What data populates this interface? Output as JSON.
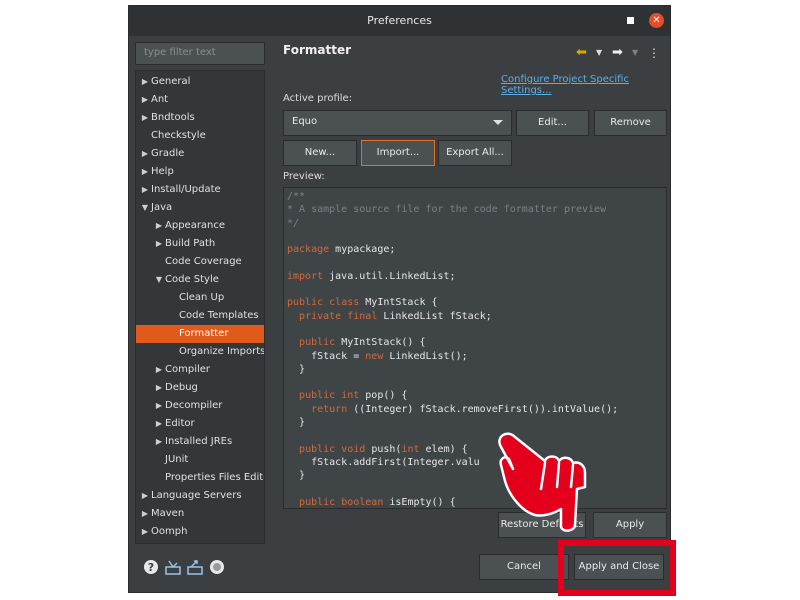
{
  "window": {
    "title": "Preferences",
    "close_glyph": "✕"
  },
  "sidebar": {
    "filter_placeholder": "type filter text",
    "items": [
      {
        "label": "General",
        "expand": "▶"
      },
      {
        "label": "Ant",
        "expand": "▶"
      },
      {
        "label": "Bndtools",
        "expand": "▶"
      },
      {
        "label": "Checkstyle",
        "expand": ""
      },
      {
        "label": "Gradle",
        "expand": "▶"
      },
      {
        "label": "Help",
        "expand": "▶"
      },
      {
        "label": "Install/Update",
        "expand": "▶"
      },
      {
        "label": "Java",
        "expand": "▼"
      },
      {
        "label": "Appearance",
        "expand": "▶"
      },
      {
        "label": "Build Path",
        "expand": "▶"
      },
      {
        "label": "Code Coverage",
        "expand": ""
      },
      {
        "label": "Code Style",
        "expand": "▼"
      },
      {
        "label": "Clean Up",
        "expand": ""
      },
      {
        "label": "Code Templates",
        "expand": ""
      },
      {
        "label": "Formatter",
        "expand": ""
      },
      {
        "label": "Organize Imports",
        "expand": ""
      },
      {
        "label": "Compiler",
        "expand": "▶"
      },
      {
        "label": "Debug",
        "expand": "▶"
      },
      {
        "label": "Decompiler",
        "expand": "▶"
      },
      {
        "label": "Editor",
        "expand": "▶"
      },
      {
        "label": "Installed JREs",
        "expand": "▶"
      },
      {
        "label": "JUnit",
        "expand": ""
      },
      {
        "label": "Properties Files Editor",
        "expand": ""
      },
      {
        "label": "Language Servers",
        "expand": "▶"
      },
      {
        "label": "Maven",
        "expand": "▶"
      },
      {
        "label": "Oomph",
        "expand": "▶"
      }
    ],
    "selected": "Formatter"
  },
  "main": {
    "title": "Formatter",
    "configure_link": "Configure Project Specific Settings...",
    "active_profile_label": "Active profile:",
    "profile_value": "Equo",
    "edit_label": "Edit...",
    "remove_label": "Remove",
    "new_label": "New...",
    "import_label": "Import...",
    "export_label": "Export All...",
    "preview_label": "Preview:",
    "code_lines": [
      [
        {
          "t": "/**",
          "c": "cm"
        }
      ],
      [
        {
          "t": "* A sample source file for the code formatter preview",
          "c": "cm"
        }
      ],
      [
        {
          "t": "*/",
          "c": "cm"
        }
      ],
      [],
      [
        {
          "t": "package",
          "c": "kw"
        },
        {
          "t": " mypackage;"
        }
      ],
      [],
      [
        {
          "t": "import",
          "c": "kw"
        },
        {
          "t": " java.util.LinkedList;"
        }
      ],
      [],
      [
        {
          "t": "public",
          "c": "kw"
        },
        {
          "t": " "
        },
        {
          "t": "class",
          "c": "kw"
        },
        {
          "t": " MyIntStack {"
        }
      ],
      [
        {
          "t": "  "
        },
        {
          "t": "private",
          "c": "kw"
        },
        {
          "t": " "
        },
        {
          "t": "final",
          "c": "kw"
        },
        {
          "t": " LinkedList fStack;"
        }
      ],
      [],
      [
        {
          "t": "  "
        },
        {
          "t": "public",
          "c": "kw"
        },
        {
          "t": " MyIntStack() {"
        }
      ],
      [
        {
          "t": "    fStack = "
        },
        {
          "t": "new",
          "c": "kw"
        },
        {
          "t": " LinkedList();"
        }
      ],
      [
        {
          "t": "  }"
        }
      ],
      [],
      [
        {
          "t": "  "
        },
        {
          "t": "public",
          "c": "kw"
        },
        {
          "t": " "
        },
        {
          "t": "int",
          "c": "kw"
        },
        {
          "t": " pop() {"
        }
      ],
      [
        {
          "t": "    "
        },
        {
          "t": "return",
          "c": "kw"
        },
        {
          "t": " ((Integer) fStack.removeFirst()).intValue();"
        }
      ],
      [
        {
          "t": "  }"
        }
      ],
      [],
      [
        {
          "t": "  "
        },
        {
          "t": "public",
          "c": "kw"
        },
        {
          "t": " "
        },
        {
          "t": "void",
          "c": "kw"
        },
        {
          "t": " push("
        },
        {
          "t": "int",
          "c": "kw"
        },
        {
          "t": " elem) {"
        }
      ],
      [
        {
          "t": "    fStack.addFirst(Integer.valu"
        }
      ],
      [
        {
          "t": "  }"
        }
      ],
      [],
      [
        {
          "t": "  "
        },
        {
          "t": "public",
          "c": "kw"
        },
        {
          "t": " "
        },
        {
          "t": "boolean",
          "c": "kw"
        },
        {
          "t": " isEmpty() {"
        }
      ]
    ],
    "restore_defaults_label": "Restore Defaults",
    "apply_label": "Apply"
  },
  "footer": {
    "cancel_label": "Cancel",
    "apply_close_label": "Apply and Close"
  },
  "colors": {
    "accent": "#e05a1c",
    "highlight_red": "#e4001c",
    "link": "#5ab0e6"
  }
}
